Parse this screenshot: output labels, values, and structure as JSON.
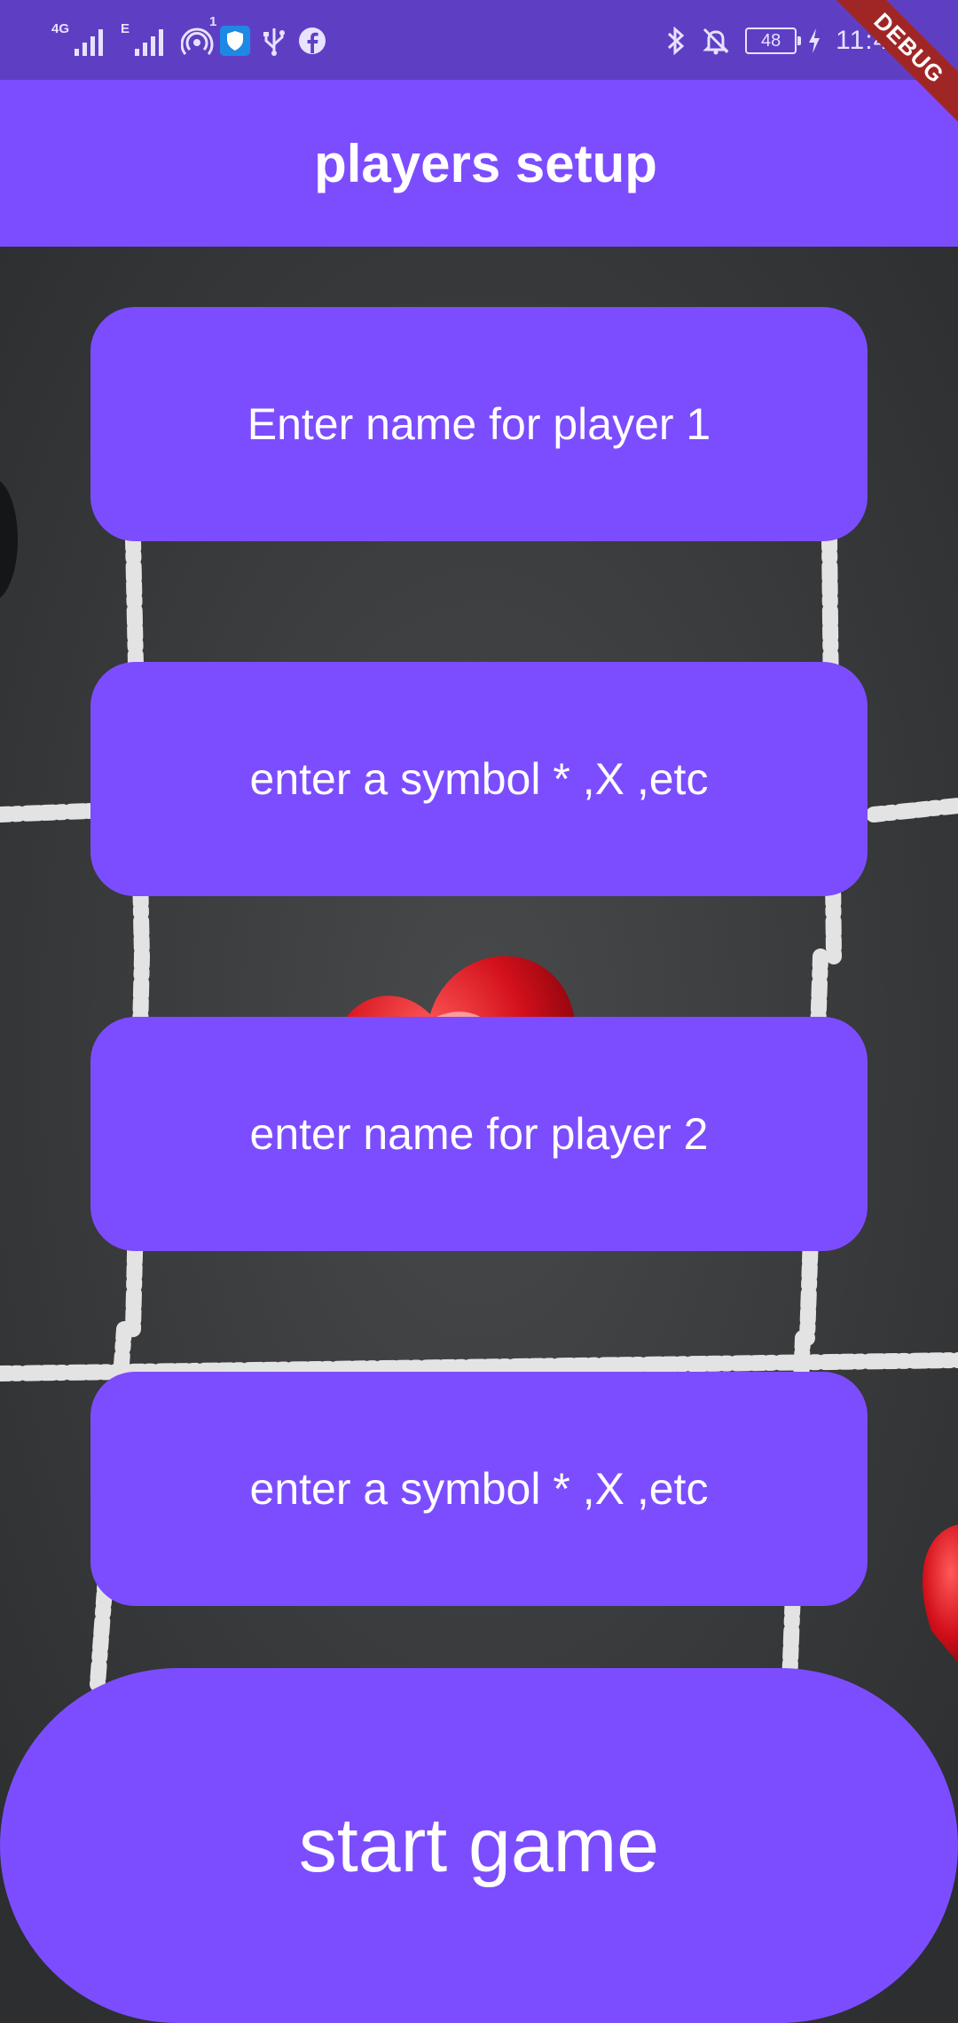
{
  "status_bar": {
    "network_1": "4G",
    "network_2": "E",
    "hotspot_badge": "1",
    "battery_level": "48",
    "time": "11:40"
  },
  "debug_banner": "DEBUG",
  "app_bar": {
    "title": "players setup"
  },
  "form": {
    "player1_name_placeholder": "Enter name for player 1",
    "player1_symbol_placeholder": "enter a symbol * ,X ,etc",
    "player2_name_placeholder": "enter name for player 2",
    "player2_symbol_placeholder": "enter a symbol * ,X ,etc"
  },
  "start_button": {
    "label": "start game"
  },
  "colors": {
    "status_bar": "#5e3fc4",
    "primary": "#7c4dff",
    "on_primary": "#ffffff",
    "debug_ribbon": "#a02626",
    "chalkboard": "#3a3c3e",
    "heart": "#d3101b"
  },
  "icons": {
    "status_left": [
      "signal-icon",
      "signal-icon",
      "hotspot-icon",
      "shield-icon",
      "usb-icon",
      "facebook-icon"
    ],
    "status_right": [
      "bluetooth-icon",
      "bell-off-icon",
      "battery-icon",
      "charging-icon"
    ]
  }
}
